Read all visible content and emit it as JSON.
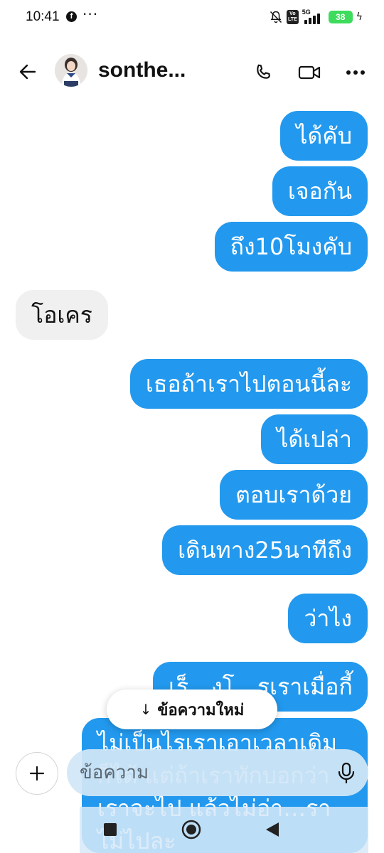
{
  "status_bar": {
    "time": "10:41",
    "dots": "···",
    "network": "5G",
    "volte_top": "Vo",
    "volte_bottom": "LTE",
    "battery": "38"
  },
  "header": {
    "contact_name": "sonthe...",
    "icons": [
      "back-arrow-icon",
      "phone-icon",
      "video-camera-icon",
      "more-options-icon"
    ]
  },
  "messages": [
    {
      "side": "outgoing",
      "text": "ได้คับ"
    },
    {
      "side": "outgoing",
      "text": "เจอกัน"
    },
    {
      "side": "outgoing",
      "text": "ถึง10โมงคับ"
    },
    {
      "side": "incoming",
      "text": "โอเคร"
    },
    {
      "side": "outgoing",
      "text": "เธอถ้าเราไปตอนนี้ละ"
    },
    {
      "side": "outgoing",
      "text": "ได้เปล่า"
    },
    {
      "side": "outgoing",
      "text": "ตอบเราด้วย"
    },
    {
      "side": "outgoing",
      "text": "เดินทาง25นาทีถึง"
    },
    {
      "side": "outgoing",
      "text": "ว่าไง"
    },
    {
      "side": "outgoing",
      "text": "เร็…งโ…รเราเมื่อกี้"
    },
    {
      "side": "outgoing",
      "text": "ไม่เป็นไรเราเอาเวลาเดิมก็ได้ แต่ถ้าเราทักบอกว่าเราจะไป แล้วไม่อ่า…ราไม่ไปละ"
    }
  ],
  "new_messages_pill": {
    "label": "ข้อความใหม่"
  },
  "composer": {
    "placeholder": "ข้อความ"
  },
  "colors": {
    "outgoing_bubble": "#2299ee",
    "incoming_bubble": "#f0f0f0",
    "battery": "#3ddc5c"
  }
}
